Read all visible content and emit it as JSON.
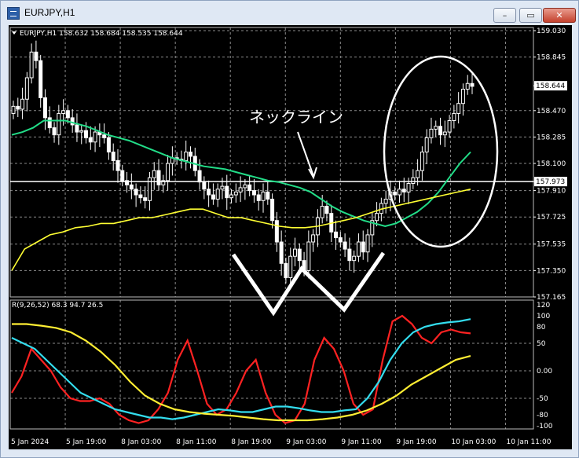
{
  "window": {
    "title": "EURJPY,H1",
    "minimize_glyph": "–",
    "restore_glyph": "▭",
    "close_glyph": "✕"
  },
  "chart_header": "EURJPY,H1  158.632 158.684 158.535 158.644",
  "indicator_header": "R(9,26,52) 68.3 94.7 26.5",
  "annotation": {
    "neckline_label": "ネックライン"
  },
  "colors": {
    "background": "#000000",
    "candles": "#ffffff",
    "grid": "#8a8a8a",
    "ma_fast": "#22dd88",
    "ma_slow": "#ffff33",
    "rsi_red": "#ff2222",
    "rsi_cyan": "#33ddee",
    "rsi_yellow": "#ffee33",
    "highlight": "#ffffff"
  },
  "chart_data": [
    {
      "type": "candlestick",
      "price_axis": [
        "159.030",
        "158.845",
        "158.644",
        "158.470",
        "158.285",
        "158.100",
        "157.973",
        "157.910",
        "157.725",
        "157.535",
        "157.350",
        "157.165"
      ],
      "ylim": [
        157.165,
        159.03
      ],
      "current_price": "158.644",
      "neckline_price": "157.973",
      "time_axis": [
        "5 Jan 2024",
        "5 Jan 19:00",
        "8 Jan 03:00",
        "8 Jan 11:00",
        "8 Jan 19:00",
        "9 Jan 03:00",
        "9 Jan 11:00",
        "9 Jan 19:00",
        "10 Jan 03:00",
        "10 Jan 11:00"
      ],
      "closes": [
        158.5,
        158.48,
        158.55,
        158.7,
        158.88,
        158.82,
        158.56,
        158.42,
        158.35,
        158.3,
        158.45,
        158.47,
        158.42,
        158.37,
        158.32,
        158.33,
        158.28,
        158.25,
        158.32,
        158.3,
        158.28,
        158.18,
        158.12,
        158.05,
        157.98,
        157.95,
        157.92,
        157.88,
        157.86,
        157.84,
        158.0,
        158.05,
        157.95,
        157.98,
        158.1,
        158.14,
        158.13,
        158.12,
        158.18,
        158.15,
        158.05,
        157.97,
        157.92,
        157.88,
        157.85,
        157.92,
        157.94,
        157.86,
        157.88,
        157.9,
        157.93,
        157.95,
        157.91,
        157.88,
        157.84,
        157.9,
        157.85,
        157.7,
        157.55,
        157.4,
        157.3,
        157.45,
        157.5,
        157.42,
        157.35,
        157.55,
        157.6,
        157.72,
        157.8,
        157.75,
        157.62,
        157.58,
        157.55,
        157.5,
        157.42,
        157.45,
        157.55,
        157.48,
        157.6,
        157.7,
        157.75,
        157.82,
        157.85,
        157.9,
        157.88,
        157.92,
        157.9,
        157.96,
        158.0,
        158.05,
        158.18,
        158.28,
        158.34,
        158.36,
        158.3,
        158.32,
        158.4,
        158.45,
        158.52,
        158.62,
        158.66,
        158.64
      ],
      "ma_fast": [
        158.3,
        158.32,
        158.35,
        158.4,
        158.4,
        158.4,
        158.38,
        158.36,
        158.33,
        158.3,
        158.28,
        158.26,
        158.23,
        158.2,
        158.17,
        158.14,
        158.12,
        158.1,
        158.08,
        158.07,
        158.06,
        158.04,
        158.02,
        158.0,
        157.98,
        157.97,
        157.95,
        157.93,
        157.9,
        157.85,
        157.8,
        157.76,
        157.73,
        157.7,
        157.68,
        157.66,
        157.68,
        157.72,
        157.76,
        157.82,
        157.9,
        158.0,
        158.1,
        158.18
      ],
      "ma_slow": [
        157.35,
        157.5,
        157.55,
        157.6,
        157.62,
        157.65,
        157.66,
        157.68,
        157.68,
        157.7,
        157.72,
        157.72,
        157.74,
        157.76,
        157.78,
        157.78,
        157.75,
        157.72,
        157.72,
        157.7,
        157.68,
        157.66,
        157.65,
        157.65,
        157.66,
        157.68,
        157.7,
        157.72,
        157.75,
        157.78,
        157.8,
        157.82,
        157.84,
        157.86,
        157.88,
        157.9,
        157.92
      ]
    },
    {
      "type": "line",
      "title": "R(9,26,52) 68.3 94.7 26.5",
      "yaxis_labels": [
        "120",
        "100",
        "80",
        "50",
        "0.00",
        "-50",
        "-80",
        "-100"
      ],
      "ylim": [
        -100,
        120
      ],
      "series": [
        {
          "values": [
            -40,
            -10,
            40,
            20,
            0,
            -30,
            -50,
            -55,
            -55,
            -50,
            -60,
            -80,
            -90,
            -95,
            -90,
            -70,
            -40,
            20,
            55,
            0,
            -60,
            -80,
            -70,
            -40,
            0,
            20,
            -40,
            -80,
            -95,
            -90,
            -60,
            20,
            60,
            40,
            0,
            -60,
            -80,
            -70,
            20,
            90,
            100,
            85,
            60,
            50,
            70,
            75,
            70,
            68
          ]
        },
        {
          "values": [
            60,
            50,
            40,
            20,
            0,
            -20,
            -40,
            -50,
            -60,
            -70,
            -75,
            -80,
            -85,
            -85,
            -88,
            -85,
            -80,
            -75,
            -70,
            -72,
            -75,
            -75,
            -70,
            -65,
            -65,
            -68,
            -72,
            -75,
            -75,
            -72,
            -70,
            -50,
            -20,
            20,
            50,
            70,
            80,
            85,
            88,
            90,
            94
          ]
        },
        {
          "values": [
            85,
            85,
            82,
            78,
            70,
            55,
            35,
            10,
            -20,
            -45,
            -60,
            -70,
            -75,
            -78,
            -80,
            -82,
            -85,
            -88,
            -90,
            -90,
            -90,
            -88,
            -85,
            -80,
            -72,
            -60,
            -45,
            -25,
            -10,
            5,
            20,
            27
          ]
        }
      ]
    }
  ]
}
